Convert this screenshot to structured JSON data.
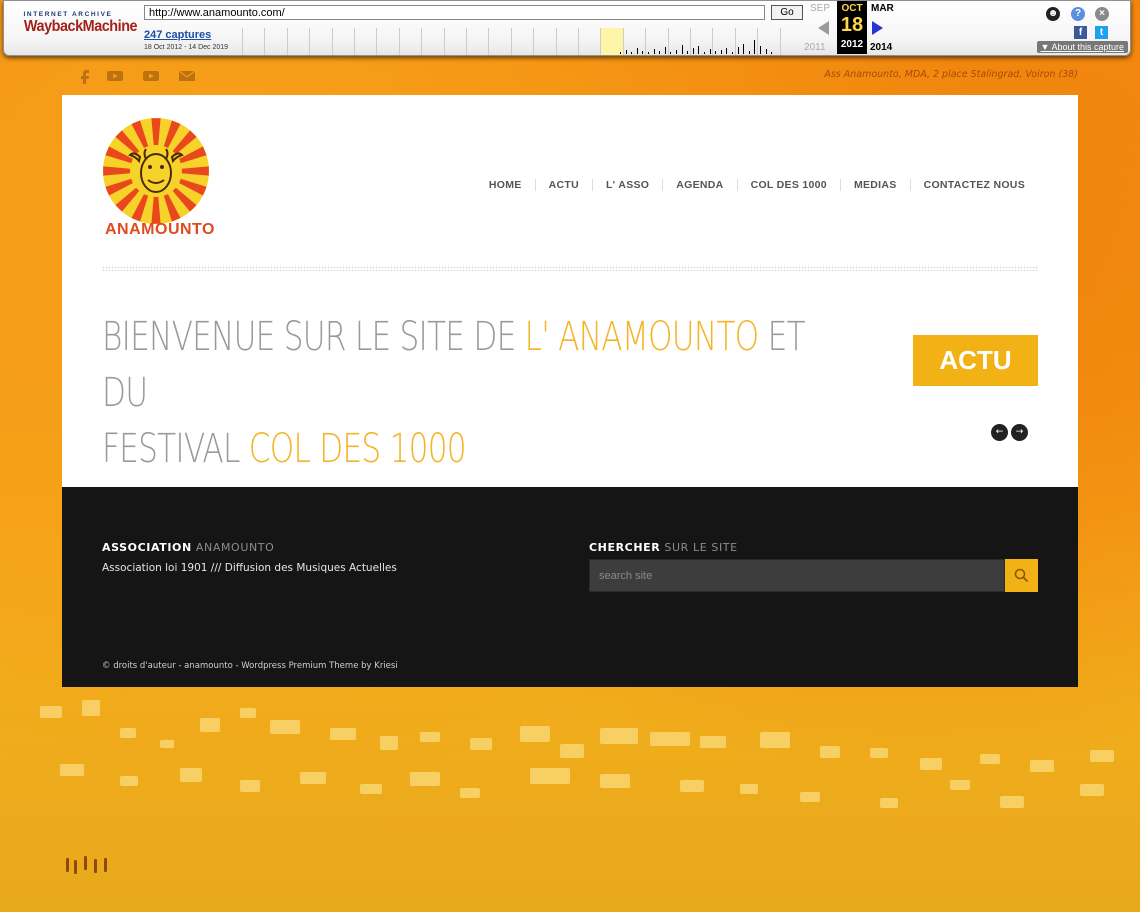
{
  "wayback": {
    "logo_top": "INTERNET ARCHIVE",
    "logo_bottom": "WaybackMachine",
    "url": "http://www.anamounto.com/",
    "go_label": "Go",
    "captures_label": "247 captures",
    "date_range": "18 Oct 2012 - 14 Dec 2019",
    "prev_month": "SEP",
    "current_month": "OCT",
    "next_month": "MAR",
    "current_day": "18",
    "prev_year": "2011",
    "current_year": "2012",
    "next_year": "2014",
    "about_label": "About this capture",
    "colors": {
      "current_bg": "#000000",
      "current_text": "#ffd84a",
      "next_arrow": "#2434d9"
    }
  },
  "topbar": {
    "social": [
      "facebook-icon",
      "youtube-icon",
      "youtube-icon",
      "mail-icon"
    ],
    "address": "Ass Anamounto, MDA, 2 place Stalingrad, Voiron (38)"
  },
  "header": {
    "logo_text": "ANAMOUNTO",
    "nav": [
      "HOME",
      "ACTU",
      "L' ASSO",
      "AGENDA",
      "COL DES 1000",
      "MEDIAS",
      "CONTACTEZ NOUS"
    ]
  },
  "hero": {
    "line1_a": "BIENVENUE SUR LE SITE DE ",
    "line1_hl": "L' ANAMOUNTO",
    "line1_b": " ET DU",
    "line2_a": "FESTIVAL ",
    "line2_hl": "COL DES 1000",
    "actu_label": "ACTU",
    "prev_arrow": "←",
    "next_arrow": "→",
    "colors": {
      "accent": "#f2b216",
      "text": "#9a9a9a"
    }
  },
  "footer": {
    "assoc_title_bold": "ASSOCIATION",
    "assoc_title_soft": " ANAMOUNTO",
    "assoc_text": "Association loi 1901 /// Diffusion des Musiques Actuelles",
    "search_title_bold": "CHERCHER",
    "search_title_soft": " SUR LE SITE",
    "search_placeholder": "search site",
    "copyright": "© droits d'auteur - anamounto - Wordpress Premium Theme by Kriesi",
    "colors": {
      "background": "#151515",
      "search_button": "#f2b216"
    }
  }
}
